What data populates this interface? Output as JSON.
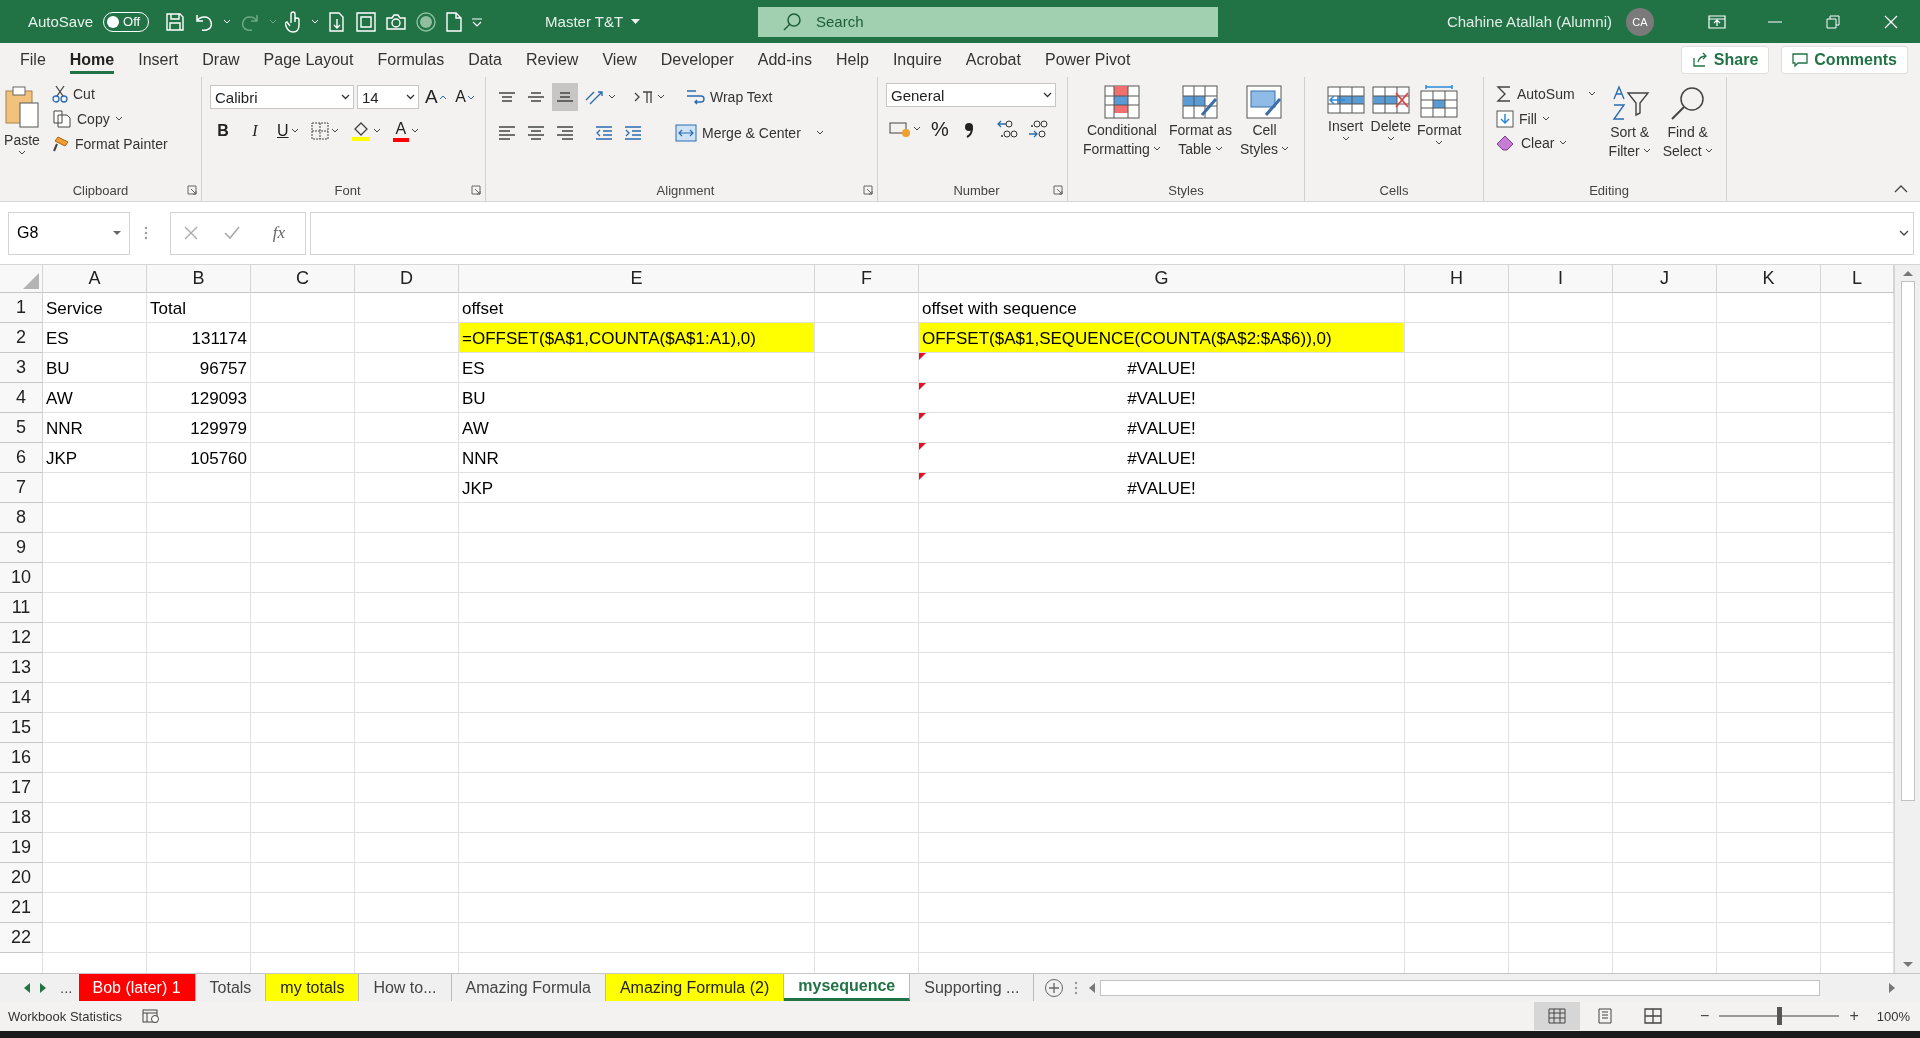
{
  "title_bar": {
    "autosave_label": "AutoSave",
    "autosave": {
      "on": false,
      "label": "Off"
    },
    "document": "Master T&T",
    "search": {
      "placeholder": "Search"
    },
    "user": "Chahine Atallah (Alumni)",
    "avatar": "CA"
  },
  "menu": {
    "tabs": [
      {
        "label": "File",
        "selected": false
      },
      {
        "label": "Home",
        "selected": true
      },
      {
        "label": "Insert",
        "selected": false
      },
      {
        "label": "Draw",
        "selected": false
      },
      {
        "label": "Page Layout",
        "selected": false
      },
      {
        "label": "Formulas",
        "selected": false
      },
      {
        "label": "Data",
        "selected": false
      },
      {
        "label": "Review",
        "selected": false
      },
      {
        "label": "View",
        "selected": false
      },
      {
        "label": "Developer",
        "selected": false
      },
      {
        "label": "Add-ins",
        "selected": false
      },
      {
        "label": "Help",
        "selected": false
      },
      {
        "label": "Inquire",
        "selected": false
      },
      {
        "label": "Acrobat",
        "selected": false
      },
      {
        "label": "Power Pivot",
        "selected": false
      }
    ],
    "share": "Share",
    "comments": "Comments"
  },
  "ribbon": {
    "clipboard": {
      "paste": "Paste",
      "cut": "Cut",
      "copy": "Copy",
      "format_painter": "Format Painter",
      "label": "Clipboard"
    },
    "font": {
      "name": "Calibri",
      "size": "14",
      "grow": "A",
      "shrink": "A",
      "bold": "B",
      "italic": "I",
      "underline": "U",
      "foreground": "A",
      "label": "Font"
    },
    "alignment": {
      "vertical_align": [
        {
          "selected": false
        },
        {
          "selected": false
        },
        {
          "selected": true
        }
      ],
      "wrap": "Wrap Text",
      "merge": "Merge & Center",
      "label": "Alignment"
    },
    "number": {
      "format": "General",
      "percent": "%",
      "label": "Number"
    },
    "styles": {
      "conditional": [
        "Conditional",
        "Formatting"
      ],
      "table": [
        "Format as",
        "Table"
      ],
      "cell": [
        "Cell",
        "Styles"
      ],
      "label": "Styles"
    },
    "cells": {
      "insert": "Insert",
      "delete": "Delete",
      "format": "Format",
      "label": "Cells"
    },
    "editing": {
      "autosum": "AutoSum",
      "fill": "Fill",
      "clear": "Clear",
      "sort": [
        "Sort &",
        "Filter"
      ],
      "find": [
        "Find &",
        "Select"
      ],
      "label": "Editing"
    }
  },
  "formula_bar": {
    "name_box": "G8",
    "fx": "fx"
  },
  "sheet": {
    "columns": [
      "A",
      "B",
      "C",
      "D",
      "E",
      "F",
      "G",
      "H",
      "I",
      "J",
      "K",
      "L"
    ],
    "rows": [
      {
        "number": "1",
        "cells": {
          "A": {
            "text": "Service",
            "kind": "text",
            "highlight": false,
            "flagged": false
          },
          "B": {
            "text": "Total",
            "kind": "text",
            "highlight": false,
            "flagged": false
          },
          "E": {
            "text": "offset",
            "kind": "text",
            "highlight": false,
            "flagged": false
          },
          "G": {
            "text": "offset with sequence",
            "kind": "text",
            "highlight": false,
            "flagged": false
          }
        }
      },
      {
        "number": "2",
        "cells": {
          "A": {
            "text": "ES",
            "kind": "text",
            "highlight": false,
            "flagged": false
          },
          "B": {
            "text": "131174",
            "kind": "number",
            "highlight": false,
            "flagged": false
          },
          "E": {
            "text": "=OFFSET($A$1,COUNTA($A$1:A1),0)",
            "kind": "text",
            "highlight": true,
            "flagged": false
          },
          "G": {
            "text": "OFFSET($A$1,SEQUENCE(COUNTA($A$2:$A$6)),0)",
            "kind": "text",
            "highlight": true,
            "flagged": false
          }
        }
      },
      {
        "number": "3",
        "cells": {
          "A": {
            "text": "BU",
            "kind": "text",
            "highlight": false,
            "flagged": false
          },
          "B": {
            "text": "96757",
            "kind": "number",
            "highlight": false,
            "flagged": false
          },
          "E": {
            "text": "ES",
            "kind": "text",
            "highlight": false,
            "flagged": false
          },
          "G": {
            "text": "#VALUE!",
            "kind": "error",
            "highlight": false,
            "flagged": true
          }
        }
      },
      {
        "number": "4",
        "cells": {
          "A": {
            "text": "AW",
            "kind": "text",
            "highlight": false,
            "flagged": false
          },
          "B": {
            "text": "129093",
            "kind": "number",
            "highlight": false,
            "flagged": false
          },
          "E": {
            "text": "BU",
            "kind": "text",
            "highlight": false,
            "flagged": false
          },
          "G": {
            "text": "#VALUE!",
            "kind": "error",
            "highlight": false,
            "flagged": true
          }
        }
      },
      {
        "number": "5",
        "cells": {
          "A": {
            "text": "NNR",
            "kind": "text",
            "highlight": false,
            "flagged": false
          },
          "B": {
            "text": "129979",
            "kind": "number",
            "highlight": false,
            "flagged": false
          },
          "E": {
            "text": "AW",
            "kind": "text",
            "highlight": false,
            "flagged": false
          },
          "G": {
            "text": "#VALUE!",
            "kind": "error",
            "highlight": false,
            "flagged": true
          }
        }
      },
      {
        "number": "6",
        "cells": {
          "A": {
            "text": "JKP",
            "kind": "text",
            "highlight": false,
            "flagged": false
          },
          "B": {
            "text": "105760",
            "kind": "number",
            "highlight": false,
            "flagged": false
          },
          "E": {
            "text": "NNR",
            "kind": "text",
            "highlight": false,
            "flagged": false
          },
          "G": {
            "text": "#VALUE!",
            "kind": "error",
            "highlight": false,
            "flagged": true
          }
        }
      },
      {
        "number": "7",
        "cells": {
          "E": {
            "text": "JKP",
            "kind": "text",
            "highlight": false,
            "flagged": false
          },
          "G": {
            "text": "#VALUE!",
            "kind": "error",
            "highlight": false,
            "flagged": true
          }
        }
      },
      {
        "number": "8"
      },
      {
        "number": "9"
      },
      {
        "number": "10"
      },
      {
        "number": "11"
      },
      {
        "number": "12"
      },
      {
        "number": "13"
      },
      {
        "number": "14"
      },
      {
        "number": "15"
      },
      {
        "number": "16"
      },
      {
        "number": "17"
      },
      {
        "number": "18"
      },
      {
        "number": "19"
      },
      {
        "number": "20"
      },
      {
        "number": "21"
      },
      {
        "number": "22"
      }
    ]
  },
  "sheet_tabs": {
    "more": "...",
    "tabs": [
      {
        "label": "Bob (later) 1",
        "color": "#ff0000",
        "selected": false
      },
      {
        "label": "Totals",
        "selected": false
      },
      {
        "label": "my totals",
        "color": "#ffff00",
        "selected": false
      },
      {
        "label": "How to...",
        "selected": false
      },
      {
        "label": "Amazing Formula",
        "selected": false
      },
      {
        "label": "Amazing Formula (2)",
        "color": "#ffff00",
        "selected": false
      },
      {
        "label": "mysequence",
        "selected": true
      },
      {
        "label": "Supporting ...",
        "selected": false
      }
    ]
  },
  "status_bar": {
    "text": "Workbook Statistics",
    "views": [
      {
        "selected": true
      },
      {
        "selected": false
      },
      {
        "selected": false
      }
    ],
    "zoom_out": "−",
    "zoom_in": "+",
    "zoom": {
      "level": 0.5,
      "label": "100%"
    }
  }
}
